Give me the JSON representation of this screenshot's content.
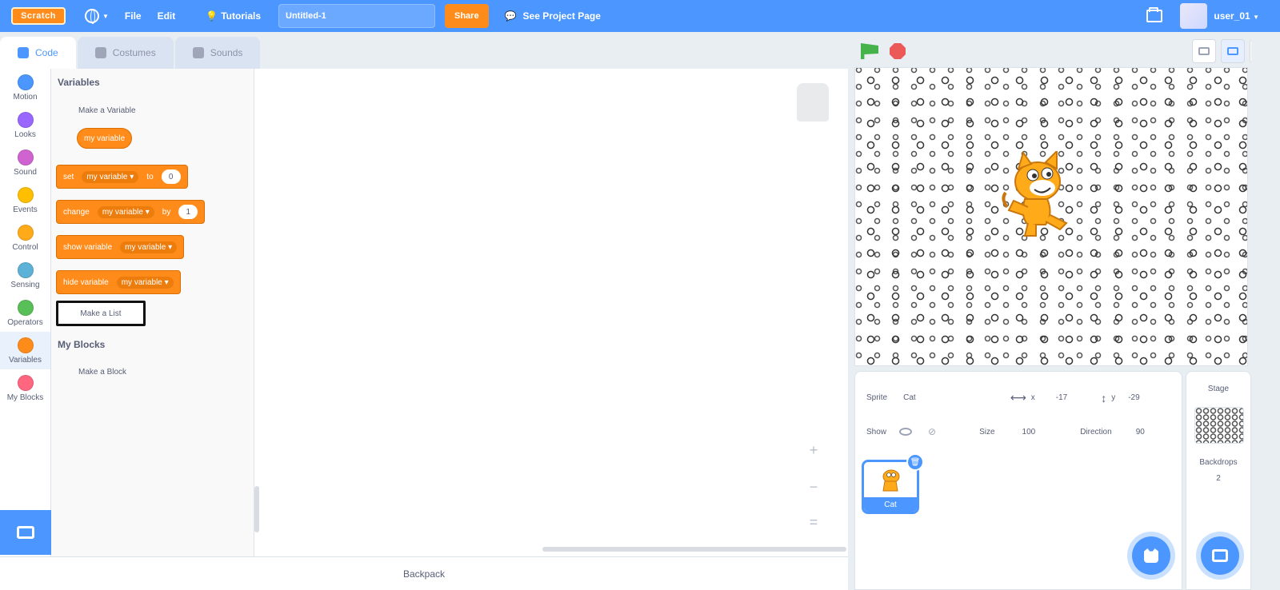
{
  "menubar": {
    "logo": "Scratch",
    "file": "File",
    "edit": "Edit",
    "tutorials": "Tutorials",
    "project_title": "Untitled-1",
    "share": "Share",
    "see_project_page": "See Project Page",
    "username": "user_01"
  },
  "tabs": [
    {
      "label": "Code",
      "icon": "code-icon"
    },
    {
      "label": "Costumes",
      "icon": "brush-icon"
    },
    {
      "label": "Sounds",
      "icon": "sound-icon"
    }
  ],
  "categories": [
    {
      "label": "Motion",
      "color": "#4c97ff"
    },
    {
      "label": "Looks",
      "color": "#9966ff"
    },
    {
      "label": "Sound",
      "color": "#cf63cf"
    },
    {
      "label": "Events",
      "color": "#ffbf00"
    },
    {
      "label": "Control",
      "color": "#ffab19"
    },
    {
      "label": "Sensing",
      "color": "#5cb1d6"
    },
    {
      "label": "Operators",
      "color": "#59c059"
    },
    {
      "label": "Variables",
      "color": "#ff8c1a"
    },
    {
      "label": "My Blocks",
      "color": "#ff6680"
    }
  ],
  "flyout": {
    "variables_heading": "Variables",
    "make_variable": "Make a Variable",
    "reporter": "my variable",
    "set_block": {
      "label": "set",
      "var": "my variable",
      "to": "to",
      "value": "0"
    },
    "change_block": {
      "label": "change",
      "var": "my variable",
      "by": "by",
      "value": "1"
    },
    "show_block": {
      "label": "show variable",
      "var": "my variable"
    },
    "hide_block": {
      "label": "hide variable",
      "var": "my variable"
    },
    "make_list": "Make a List",
    "myblocks_heading": "My Blocks",
    "make_block": "Make a Block"
  },
  "workspace": {
    "zoom_in": "+",
    "zoom_out": "−",
    "zoom_reset": "="
  },
  "backpack": "Backpack",
  "sprite_info": {
    "sprite_label": "Sprite",
    "sprite_name": "Cat",
    "x_label": "x",
    "x_value": "-17",
    "y_label": "y",
    "y_value": "-29",
    "show_label": "Show",
    "size_label": "Size",
    "size_value": "100",
    "direction_label": "Direction",
    "direction_value": "90"
  },
  "sprites": [
    {
      "name": "Cat"
    }
  ],
  "stage_selector": {
    "label": "Stage",
    "backdrops_label": "Backdrops",
    "backdrops_count": "2"
  }
}
